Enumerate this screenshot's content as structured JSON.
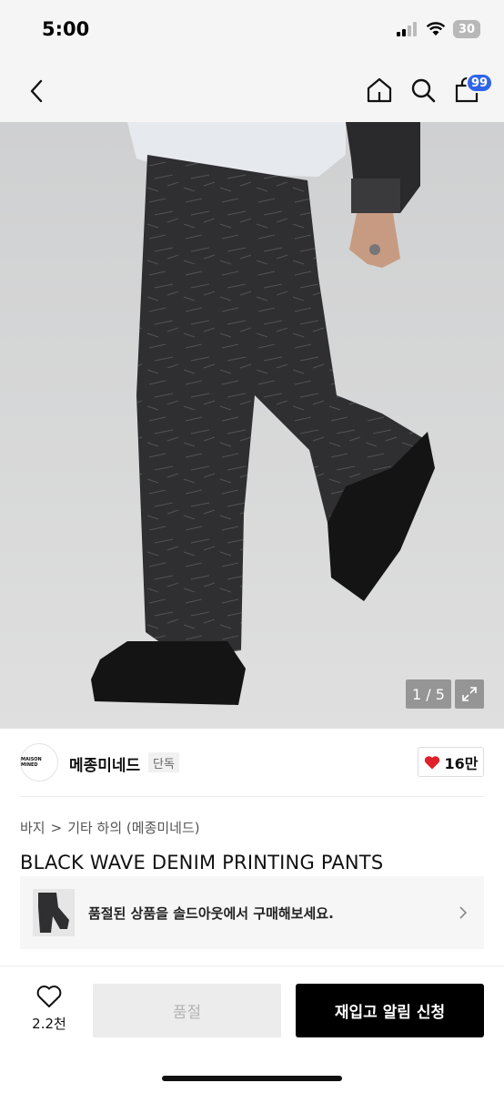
{
  "status_bar": {
    "time": "5:00",
    "battery": "30"
  },
  "nav": {
    "cart_badge": "99"
  },
  "gallery": {
    "counter": "1 / 5"
  },
  "brand": {
    "logo_text": "MAISON MINED",
    "name": "메종미네드",
    "badge": "단독",
    "likes": "16만"
  },
  "breadcrumb": {
    "category": "바지",
    "separator": ">",
    "subcategory": "기타 하의 (메종미네드)"
  },
  "product": {
    "title": "BLACK WAVE DENIM PRINTING PANTS"
  },
  "soldout_banner": {
    "text": "품절된 상품을 솔드아웃에서 구매해보세요."
  },
  "bottom_bar": {
    "wish_count": "2.2천",
    "soldout_label": "품절",
    "restock_label": "재입고 알림 신청"
  },
  "colors": {
    "accent_blue": "#2f64e8",
    "heart_red": "#e0202a",
    "primary_black": "#000000"
  },
  "icons": [
    "back-icon",
    "home-icon",
    "search-icon",
    "bag-icon",
    "expand-icon",
    "heart-icon",
    "chevron-right-icon",
    "heart-outline-icon"
  ]
}
